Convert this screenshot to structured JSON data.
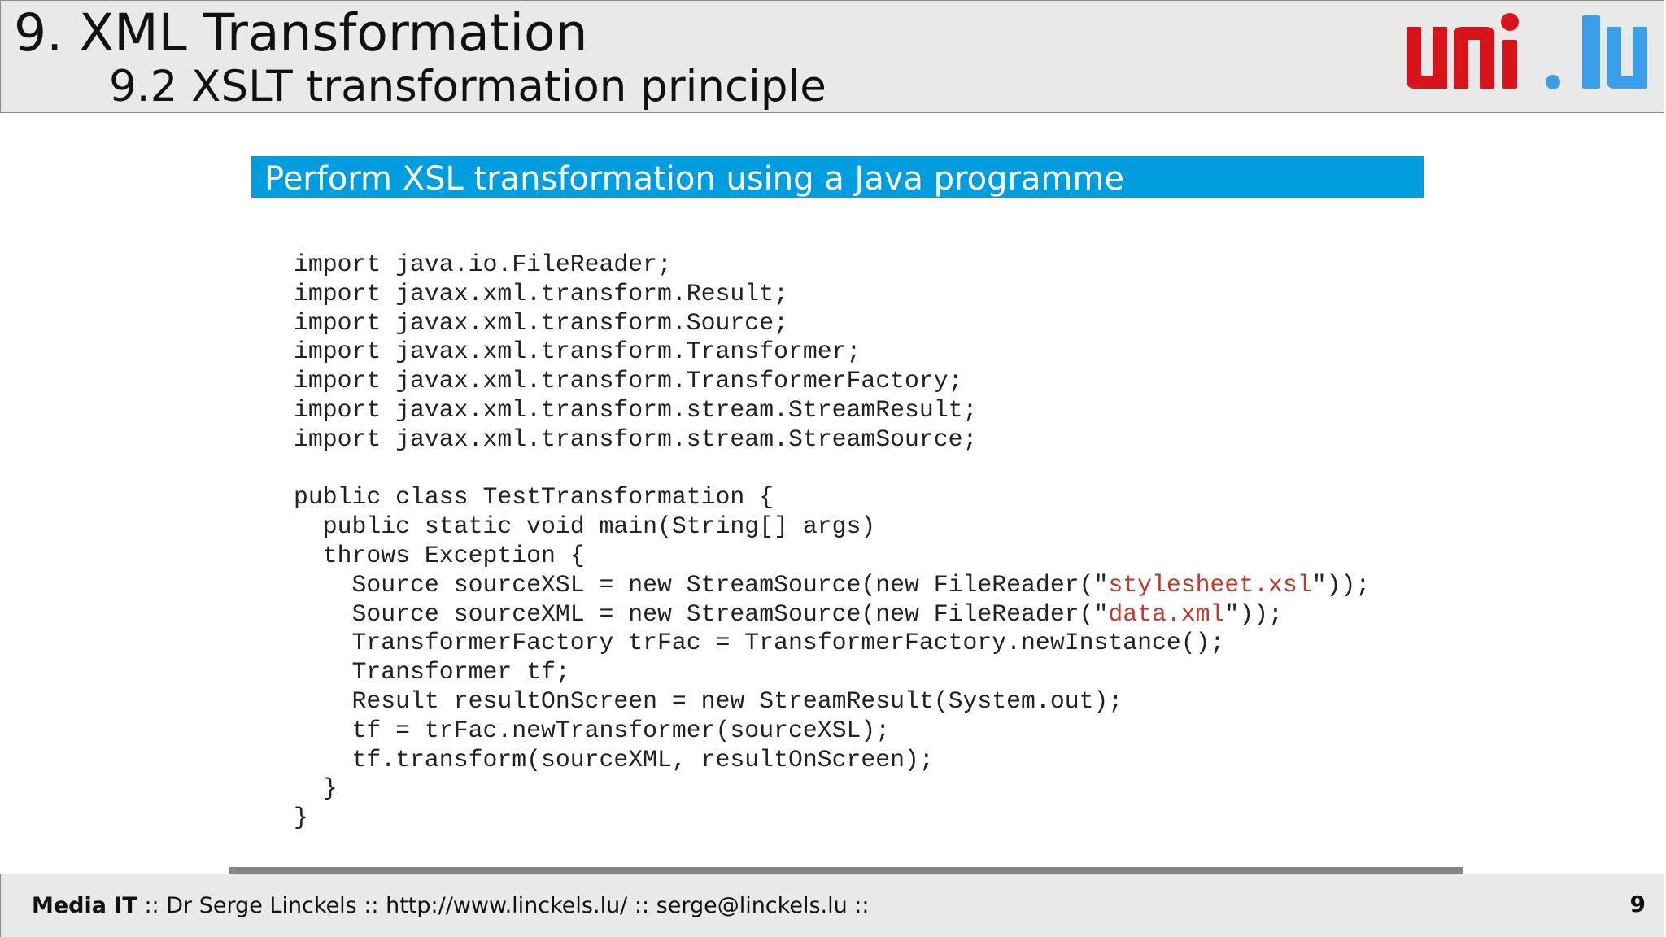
{
  "header": {
    "title": "9. XML Transformation",
    "subtitle": "9.2 XSLT transformation principle",
    "logo": {
      "text": "uni.lu",
      "colors": {
        "uni": "#d7141a",
        "dot": "#3a9ee8",
        "lu": "#3a9ee8"
      }
    }
  },
  "banner": {
    "text": "Perform XSL transformation using a Java programme",
    "color": "#009ede"
  },
  "code": {
    "lines": [
      {
        "text": "import java.io.FileReader;"
      },
      {
        "text": "import javax.xml.transform.Result;"
      },
      {
        "text": "import javax.xml.transform.Source;"
      },
      {
        "text": "import javax.xml.transform.Transformer;"
      },
      {
        "text": "import javax.xml.transform.TransformerFactory;"
      },
      {
        "text": "import javax.xml.transform.stream.StreamResult;"
      },
      {
        "text": "import javax.xml.transform.stream.StreamSource;"
      },
      {
        "text": ""
      },
      {
        "text": "public class TestTransformation {"
      },
      {
        "text": "  public static void main(String[] args)"
      },
      {
        "text": "  throws Exception {"
      },
      {
        "pre": "    Source sourceXSL = new StreamSource(new FileReader(\"",
        "str": "stylesheet.xsl",
        "post": "\"));"
      },
      {
        "pre": "    Source sourceXML = new StreamSource(new FileReader(\"",
        "str": "data.xml",
        "post": "\"));"
      },
      {
        "text": "    TransformerFactory trFac = TransformerFactory.newInstance();"
      },
      {
        "text": "    Transformer tf;"
      },
      {
        "text": "    Result resultOnScreen = new StreamResult(System.out);"
      },
      {
        "text": "    tf = trFac.newTransformer(sourceXSL);"
      },
      {
        "text": "    tf.transform(sourceXML, resultOnScreen);"
      },
      {
        "text": "  }"
      },
      {
        "text": "}"
      }
    ],
    "string_color": "#c0392b"
  },
  "footer": {
    "brand": "Media IT",
    "text": " :: Dr Serge Linckels :: http://www.linckels.lu/ :: serge@linckels.lu ::",
    "page_number": "9"
  }
}
